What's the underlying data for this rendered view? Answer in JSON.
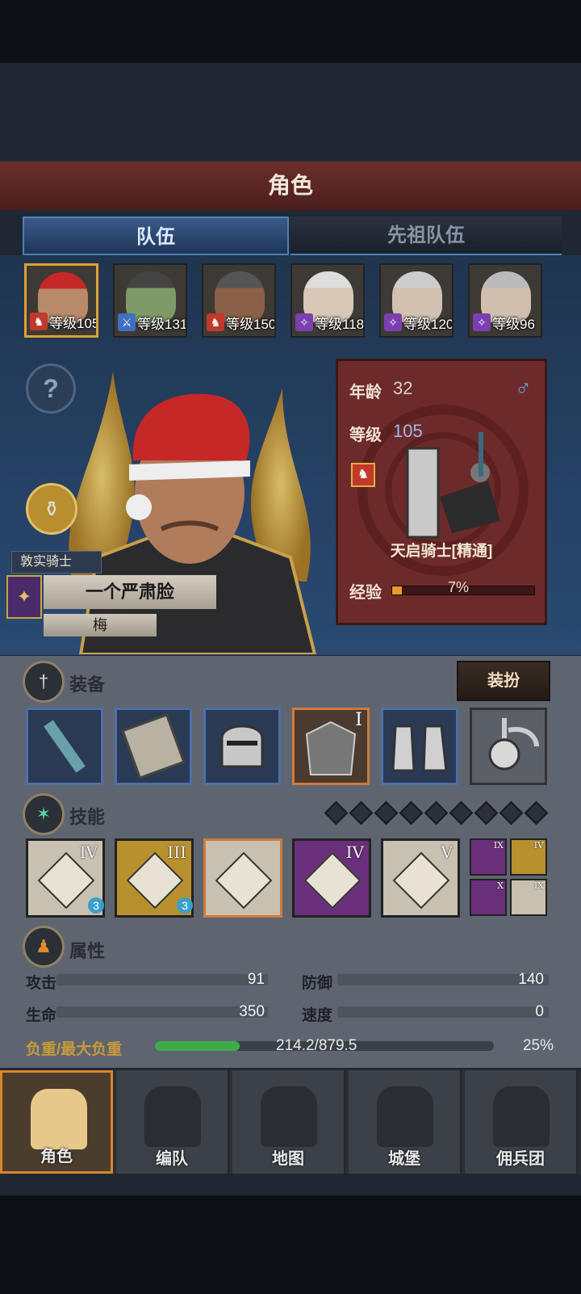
{
  "title": "角色",
  "tabs": [
    {
      "label": "队伍"
    },
    {
      "label": "先祖队伍"
    }
  ],
  "team": [
    {
      "level_text": "等级105",
      "class_icon": "horse-icon",
      "class_color": "#c0392b",
      "skin": "#b88a6a",
      "hat": "#c62828"
    },
    {
      "level_text": "等级131",
      "class_icon": "sword-icon",
      "class_color": "#3f6fc0",
      "skin": "#7d9a68",
      "hat": "#444"
    },
    {
      "level_text": "等级150",
      "class_icon": "horse-icon",
      "class_color": "#c0392b",
      "skin": "#8a6048",
      "hat": "#555"
    },
    {
      "level_text": "等级118",
      "class_icon": "staff-icon",
      "class_color": "#7b3fb0",
      "skin": "#d9c7b8",
      "hat": "#ddd"
    },
    {
      "level_text": "等级120",
      "class_icon": "staff-icon",
      "class_color": "#7b3fb0",
      "skin": "#d2c0b0",
      "hat": "#ccc"
    },
    {
      "level_text": "等级96",
      "class_icon": "staff-icon",
      "class_color": "#7b3fb0",
      "skin": "#d0beae",
      "hat": "#bbb"
    }
  ],
  "hero": {
    "title_badge": "敦实骑士",
    "name": "一个严肃脸",
    "subname": "梅",
    "age_label": "年龄",
    "age": "32",
    "level_label": "等级",
    "level": "105",
    "class_name": "天启骑士[精通]",
    "exp_label": "经验",
    "exp_percent": "7%",
    "exp_fraction": 0.07
  },
  "equipment": {
    "label": "装备",
    "outfit_button": "装扮",
    "items": [
      {
        "icon": "mace-icon"
      },
      {
        "icon": "shield-icon"
      },
      {
        "icon": "helmet-icon"
      },
      {
        "icon": "armor-icon",
        "tier": "I"
      },
      {
        "icon": "boots-icon"
      },
      {
        "icon": "amulet-icon"
      }
    ]
  },
  "skills": {
    "label": "技能",
    "slots_total": 9,
    "items": [
      {
        "tier": "IV",
        "badge": "3",
        "bg": "#c8c0b0"
      },
      {
        "tier": "III",
        "badge": "3",
        "bg": "#b8902e"
      },
      {
        "tier": "",
        "badge": "",
        "bg": "#c8c0b0"
      },
      {
        "tier": "IV",
        "badge": "",
        "bg": "#6a2f7a"
      },
      {
        "tier": "V",
        "badge": "",
        "bg": "#c8c0b0"
      }
    ],
    "mini": [
      {
        "tier": "IX",
        "bg": "#6a2f7a"
      },
      {
        "tier": "IV",
        "bg": "#b8902e"
      },
      {
        "tier": "X",
        "bg": "#6a2f7a"
      },
      {
        "tier": "IX",
        "bg": "#c8c0b0"
      }
    ]
  },
  "attributes": {
    "label": "属性",
    "attack_label": "攻击",
    "attack": "91",
    "defense_label": "防御",
    "defense": "140",
    "hp_label": "生命",
    "hp": "350",
    "speed_label": "速度",
    "speed": "0",
    "load_label": "负重/最大负重",
    "load": "214.2/879.5",
    "load_percent": "25%",
    "load_fraction": 0.25
  },
  "nav": [
    {
      "label": "角色",
      "icon": "knight-icon"
    },
    {
      "label": "编队",
      "icon": "formation-icon"
    },
    {
      "label": "地图",
      "icon": "map-icon"
    },
    {
      "label": "城堡",
      "icon": "castle-icon"
    },
    {
      "label": "佣兵团",
      "icon": "mercenary-icon"
    }
  ]
}
